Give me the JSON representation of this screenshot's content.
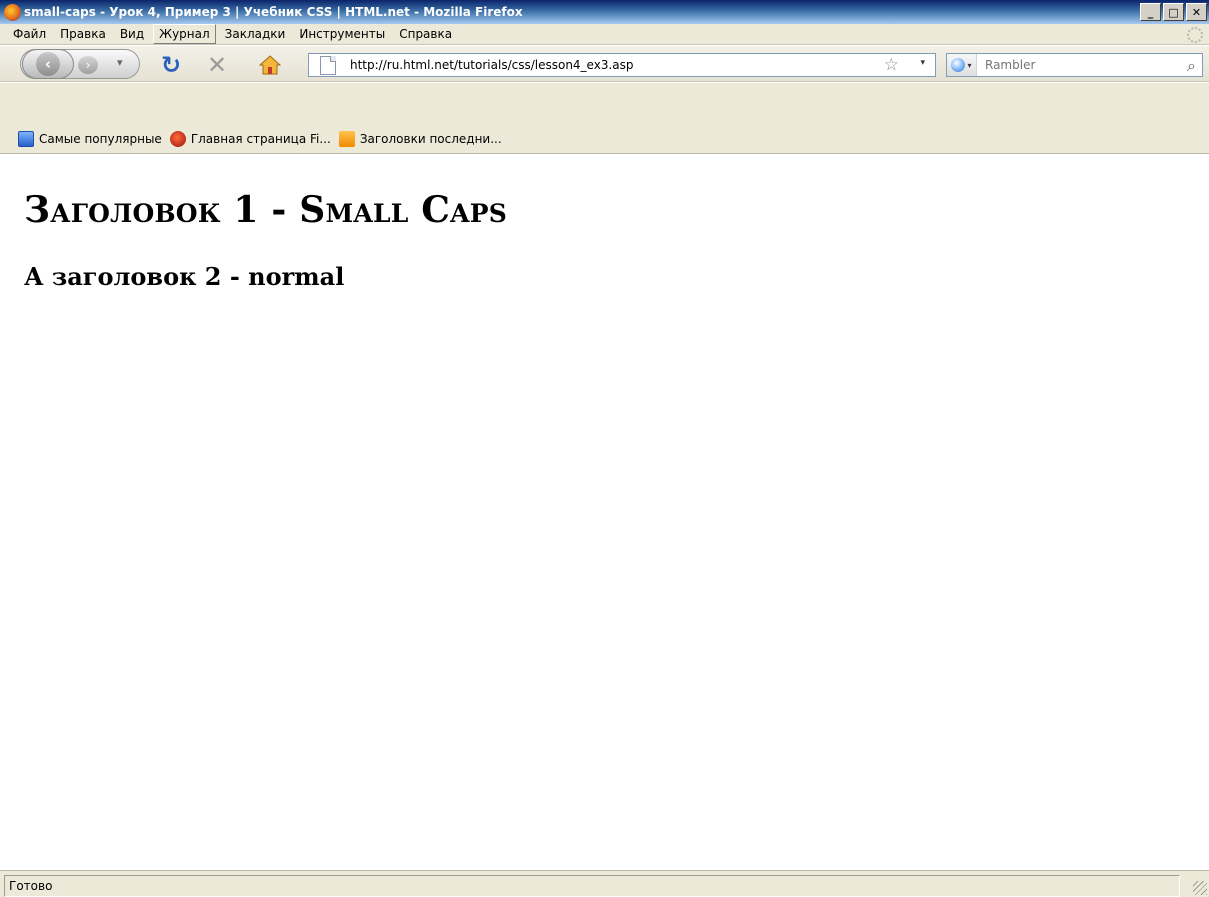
{
  "window": {
    "title": "small-caps - Урок 4, Пример 3 | Учебник CSS | HTML.net - Mozilla Firefox",
    "controls": {
      "minimize": "_",
      "maximize": "□",
      "close": "✕"
    }
  },
  "menu": {
    "items": [
      {
        "label": "Файл"
      },
      {
        "label": "Правка"
      },
      {
        "label": "Вид"
      },
      {
        "label": "Журнал"
      },
      {
        "label": "Закладки"
      },
      {
        "label": "Инструменты"
      },
      {
        "label": "Справка"
      }
    ],
    "active_item": "Журнал"
  },
  "navigation": {
    "back_glyph": "‹",
    "forward_glyph": "›",
    "history_glyph": "▾",
    "reload_glyph": "↻",
    "stop_glyph": "✕",
    "url": "http://ru.html.net/tutorials/css/lesson4_ex3.asp",
    "bookmark_star": "☆",
    "url_dropdown": "▾"
  },
  "search": {
    "engine_dropdown": "▾",
    "placeholder": "Rambler",
    "go_glyph": "⌕"
  },
  "bookmarks": {
    "items": [
      {
        "label": "Самые популярные",
        "icon": "popular-icon"
      },
      {
        "label": "Главная страница Fi...",
        "icon": "firefox-icon"
      },
      {
        "label": "Заголовки последни...",
        "icon": "rss-icon"
      }
    ]
  },
  "content": {
    "heading1": "Заголовок 1 - Small Caps",
    "heading2": "А заголовок 2 - normal"
  },
  "status": {
    "text": "Готово"
  }
}
